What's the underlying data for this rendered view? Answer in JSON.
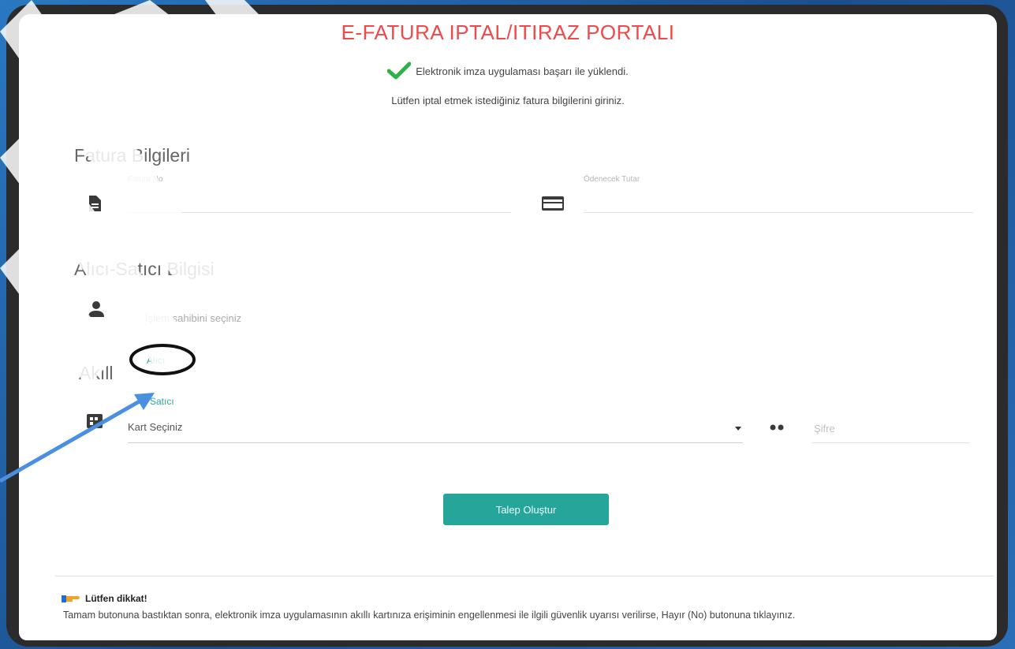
{
  "portal": {
    "title": "E-FATURA IPTAL/ITIRAZ PORTALI",
    "success_message": "Elektronik imza uygulaması başarı ile yüklendi.",
    "instruction": "Lütfen iptal etmek istediğiniz fatura bilgilerini giriniz."
  },
  "invoice_section": {
    "title": "Fatura Bilgileri",
    "fields": [
      {
        "label": "Fatura No",
        "value": "",
        "icon": "document-icon"
      },
      {
        "label": "Ödenecek Tutar",
        "value": "",
        "icon": "credit-card-icon"
      }
    ]
  },
  "party_section": {
    "title": "Alıcı-Satıcı Bilgisi",
    "placeholder": "İşlem sahibini seçiniz",
    "icon": "person-icon",
    "options": [
      "Alıcı",
      "Satıcı"
    ]
  },
  "smartcard_section": {
    "title": "Akıll",
    "select_value": "Kart Seçiniz",
    "pin_placeholder": "Şifre",
    "icon": "smartcard-icon"
  },
  "actions": {
    "submit_label": "Talep Oluştur"
  },
  "notice": {
    "heading": "Lütfen dikkat!",
    "body": "Tamam butonuna bastıktan sonra, elektronik imza uygulamasının akıllı kartınıza erişiminin engellenmesi ile ilgili güvenlik uyarısı verilirse, Hayır (No) butonuna tıklayınız."
  },
  "colors": {
    "title": "#f2484a",
    "accent": "#26a69a",
    "watermark": "#ffffff",
    "annotation_arrow": "#4a8fe0"
  }
}
